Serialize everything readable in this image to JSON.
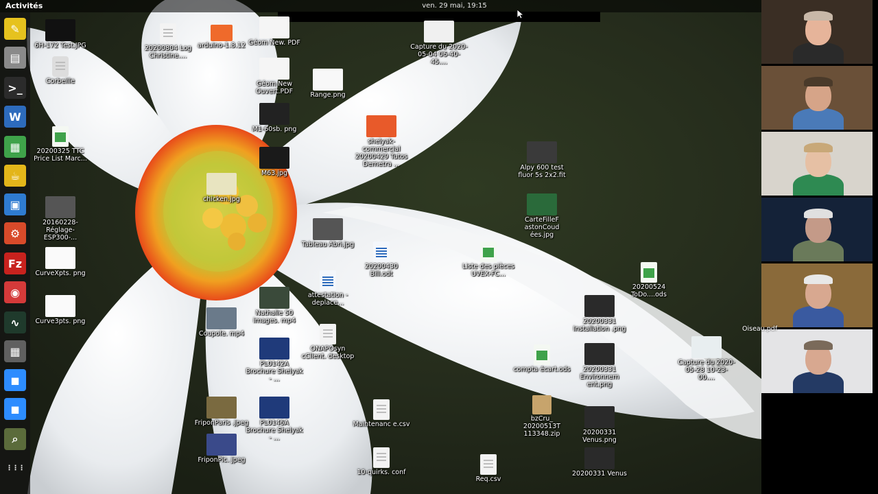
{
  "topbar": {
    "activities": "Activités",
    "clock": "ven. 29 mai, 19:15"
  },
  "dock": [
    {
      "name": "pen-app-icon",
      "glyph": "✎",
      "color": "#e6c21e"
    },
    {
      "name": "files-icon",
      "glyph": "▤",
      "color": "#8a8a8a"
    },
    {
      "name": "terminal-icon",
      "glyph": ">_",
      "color": "#2b2b2b"
    },
    {
      "name": "writer-icon",
      "glyph": "W",
      "color": "#2d6bbd"
    },
    {
      "name": "calc-icon",
      "glyph": "▦",
      "color": "#3fa24a"
    },
    {
      "name": "teapot-icon",
      "glyph": "☕",
      "color": "#e3b51a"
    },
    {
      "name": "virtualbox-icon",
      "glyph": "▣",
      "color": "#2f7bd1"
    },
    {
      "name": "settings-icon",
      "glyph": "⚙",
      "color": "#d84a2a"
    },
    {
      "name": "filezilla-icon",
      "glyph": "Fz",
      "color": "#c8221e"
    },
    {
      "name": "ghost-app-icon",
      "glyph": "◉",
      "color": "#d43a3a"
    },
    {
      "name": "system-monitor-icon",
      "glyph": "∿",
      "color": "#1f3a2c"
    },
    {
      "name": "calculator-icon",
      "glyph": "▦",
      "color": "#606060"
    },
    {
      "name": "zoom-icon",
      "glyph": "◼",
      "color": "#2d8cff"
    },
    {
      "name": "zoom-meeting-icon",
      "glyph": "◼",
      "color": "#2d8cff"
    },
    {
      "name": "magnifier-icon",
      "glyph": "⌕",
      "color": "#5b6b3b"
    },
    {
      "name": "app-grid-icon",
      "glyph": "⋮⋮⋮",
      "color": "transparent"
    }
  ],
  "desktop_icons": [
    {
      "label": "6H-172 Test.JPG",
      "kind": "img",
      "color": "#111"
    },
    {
      "label": "Corbeille",
      "kind": "trash",
      "color": "#ddd"
    },
    {
      "label": "20200325 TTC Price List Marc...",
      "kind": "sheet"
    },
    {
      "label": "20160228-Réglage-ESP300-...",
      "kind": "img",
      "color": "#555"
    },
    {
      "label": "CurveXpts. png",
      "kind": "img",
      "color": "#fafafa"
    },
    {
      "label": "Curve3pts. png",
      "kind": "img",
      "color": "#fafafa"
    },
    {
      "label": "20200804 Log Christine....",
      "kind": "doc"
    },
    {
      "label": "arduino-1.8.12",
      "kind": "folder"
    },
    {
      "label": "chicken.jpg",
      "kind": "img",
      "color": "#e8e4c0"
    },
    {
      "label": "Coupole. mp4",
      "kind": "img",
      "color": "#6a7a8a"
    },
    {
      "label": "FriponParis .jpeg",
      "kind": "img",
      "color": "#7a6a40"
    },
    {
      "label": "FriponPic. jpeg",
      "kind": "img",
      "color": "#3a4a8a"
    },
    {
      "label": "Géom New. PDF",
      "kind": "img",
      "color": "#f5f5f5"
    },
    {
      "label": "Géom New Ouvert.PDF",
      "kind": "img",
      "color": "#f5f5f5"
    },
    {
      "label": "M1-60sb. png",
      "kind": "img",
      "color": "#222"
    },
    {
      "label": "M63.jpg",
      "kind": "img",
      "color": "#1a1a1a"
    },
    {
      "label": "Nathalie 50 images. mp4",
      "kind": "img",
      "color": "#3a4a3a"
    },
    {
      "label": "PL0142A Brochure Shelyak - ...",
      "kind": "img",
      "color": "#1f3a7a"
    },
    {
      "label": "PL0146A Brochure Shelyak - ...",
      "kind": "img",
      "color": "#1f3a7a"
    },
    {
      "label": "Range.png",
      "kind": "img",
      "color": "#f8f8f8"
    },
    {
      "label": "Tableau Abri.jpg",
      "kind": "img",
      "color": "#555"
    },
    {
      "label": "attestation - deplace...",
      "kind": "writer"
    },
    {
      "label": "ONAPOsyn cClient. desktop",
      "kind": "doc"
    },
    {
      "label": "shelyak-commercial 20200429 Tutos Demetra ...",
      "kind": "img",
      "color": "#e85a2a"
    },
    {
      "label": "20200430 Bill.odt",
      "kind": "writer"
    },
    {
      "label": "Maintenanc e.csv",
      "kind": "doc"
    },
    {
      "label": "10-quirks. conf",
      "kind": "doc"
    },
    {
      "label": "Capture du 2020-05-04 06-40-45....",
      "kind": "img",
      "color": "#f0f0f0"
    },
    {
      "label": "Liste des pièces UVEX-FC...",
      "kind": "sheet"
    },
    {
      "label": "Req.csv",
      "kind": "doc"
    },
    {
      "label": "Alpy 600 test fluor 5s 2x2.fit",
      "kind": "img",
      "color": "#3a3a3a"
    },
    {
      "label": "CarteFilleF astonCoud ées.jpg",
      "kind": "img",
      "color": "#2a6a3a"
    },
    {
      "label": "compta écart.ods",
      "kind": "sheet"
    },
    {
      "label": "bzCru_ 20200513T 113348.zip",
      "kind": "zip"
    },
    {
      "label": "20200331 Installation .png",
      "kind": "img",
      "color": "#2a2a2a"
    },
    {
      "label": "20200331 Environnem ent.png",
      "kind": "img",
      "color": "#2a2a2a"
    },
    {
      "label": "20200331 Venus.png",
      "kind": "img",
      "color": "#2a2a2a"
    },
    {
      "label": "20200331 Venus",
      "kind": "img",
      "color": "#2a2a2a"
    },
    {
      "label": "20200524 ToDo....ods",
      "kind": "sheet"
    },
    {
      "label": "Capture du 2020-05-28 10-23-00....",
      "kind": "img",
      "color": "#e8eef0"
    }
  ],
  "participants": [
    {
      "wall": "#3a2e24",
      "skin": "#e6b49a",
      "shirt": "#2a2a2a",
      "hair": "#c8b8a8"
    },
    {
      "wall": "#6a5038",
      "skin": "#d6a488",
      "shirt": "#4a7ab8",
      "hair": "#4a3a2a"
    },
    {
      "wall": "#d8d4cc",
      "skin": "#e6c0a4",
      "shirt": "#2e8a52",
      "hair": "#c8a878"
    },
    {
      "wall": "#142238",
      "skin": "#c49a88",
      "shirt": "#6a7a5a",
      "hair": "#e0e0e0"
    },
    {
      "wall": "#8a6a3a",
      "skin": "#d8a890",
      "shirt": "#3a5aa0",
      "hair": "#e8e8e8"
    },
    {
      "wall": "#e4e4e6",
      "skin": "#d8a890",
      "shirt": "#243a64",
      "hair": "#7a6a5a"
    }
  ],
  "overflow_label": "Oiseau.pdf"
}
